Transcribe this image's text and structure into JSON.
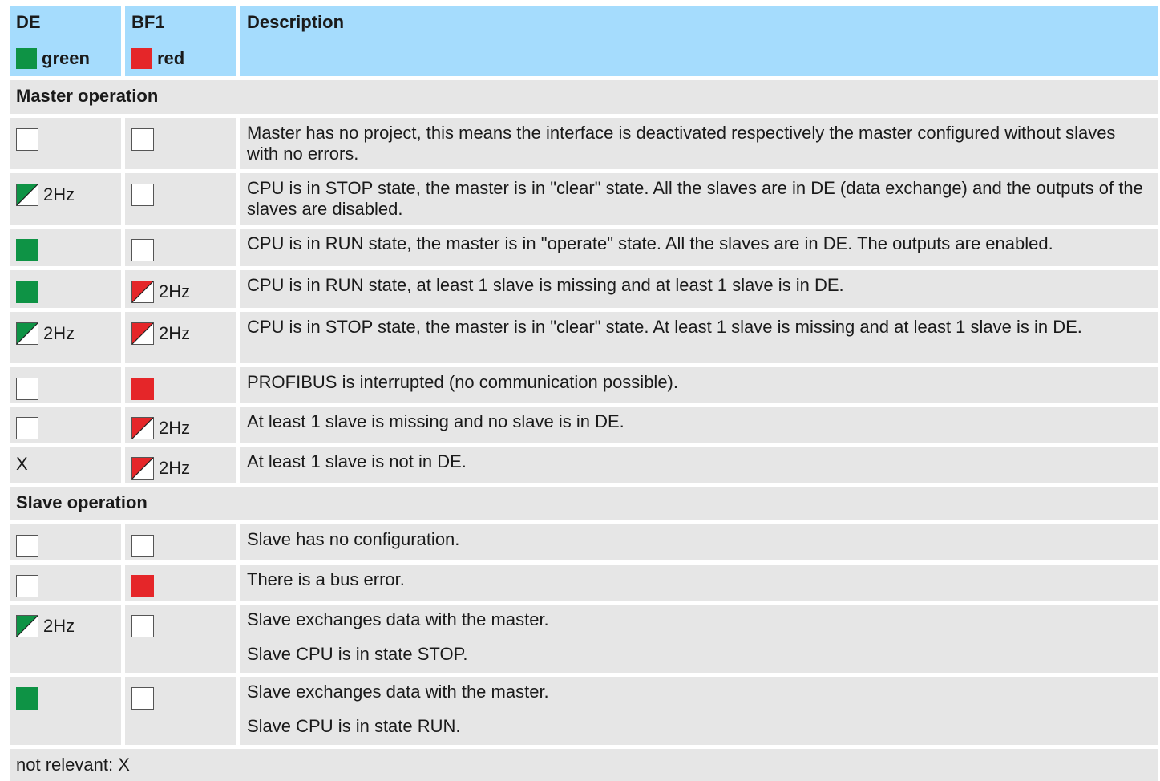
{
  "header": {
    "de_title": "DE",
    "de_color": "green",
    "bf1_title": "BF1",
    "bf1_color": "red",
    "description_title": "Description"
  },
  "colors": {
    "header_bg": "#a5dcfd",
    "row_bg": "#e6e6e6",
    "led_green": "#0e9345",
    "led_red": "#e52629"
  },
  "master_section": {
    "title": "Master operation",
    "rows": [
      {
        "de": "off",
        "de_label": "",
        "bf1": "off",
        "bf1_label": "",
        "text": [
          "Master has no project, this means the interface is deactivated respectively the master configured without slaves with no errors."
        ]
      },
      {
        "de": "blink-green",
        "de_label": "2Hz",
        "bf1": "off",
        "bf1_label": "",
        "text": [
          "CPU is in STOP state, the master is in \"clear\" state. All the slaves are in DE (data exchange) and the outputs of the slaves are disabled."
        ]
      },
      {
        "de": "on-green",
        "de_label": "",
        "bf1": "off",
        "bf1_label": "",
        "text": [
          "CPU is in RUN state, the master is in \"operate\" state. All the slaves are in DE. The outputs are enabled."
        ]
      },
      {
        "de": "on-green",
        "de_label": "",
        "bf1": "blink-red",
        "bf1_label": "2Hz",
        "text": [
          "CPU is in RUN state, at least 1 slave is missing and at least 1 slave is in DE."
        ]
      },
      {
        "de": "blink-green",
        "de_label": "2Hz",
        "bf1": "blink-red",
        "bf1_label": "2Hz",
        "text": [
          "CPU is in STOP state, the master is in \"clear\" state. At least 1 slave is missing and at least 1 slave is in DE."
        ]
      },
      {
        "de": "off",
        "de_label": "",
        "bf1": "on-red",
        "bf1_label": "",
        "text": [
          "PROFIBUS is interrupted (no communication possible)."
        ]
      },
      {
        "de": "off",
        "de_label": "",
        "bf1": "blink-red",
        "bf1_label": "2Hz",
        "text": [
          "At least 1 slave is missing and no slave is in DE."
        ]
      },
      {
        "de": "x",
        "de_label": "X",
        "bf1": "blink-red",
        "bf1_label": "2Hz",
        "text": [
          "At least 1 slave is not in DE."
        ]
      }
    ]
  },
  "slave_section": {
    "title": "Slave operation",
    "rows": [
      {
        "de": "off",
        "de_label": "",
        "bf1": "off",
        "bf1_label": "",
        "text": [
          "Slave has no configuration."
        ]
      },
      {
        "de": "off",
        "de_label": "",
        "bf1": "on-red",
        "bf1_label": "",
        "text": [
          "There is a bus error."
        ]
      },
      {
        "de": "blink-green",
        "de_label": "2Hz",
        "bf1": "off",
        "bf1_label": "",
        "text": [
          "Slave exchanges data with the master.",
          "Slave CPU is in state STOP."
        ]
      },
      {
        "de": "on-green",
        "de_label": "",
        "bf1": "off",
        "bf1_label": "",
        "text": [
          "Slave exchanges data with the master.",
          "Slave CPU is in state RUN."
        ]
      }
    ]
  },
  "footer": {
    "note": "not relevant: X"
  }
}
